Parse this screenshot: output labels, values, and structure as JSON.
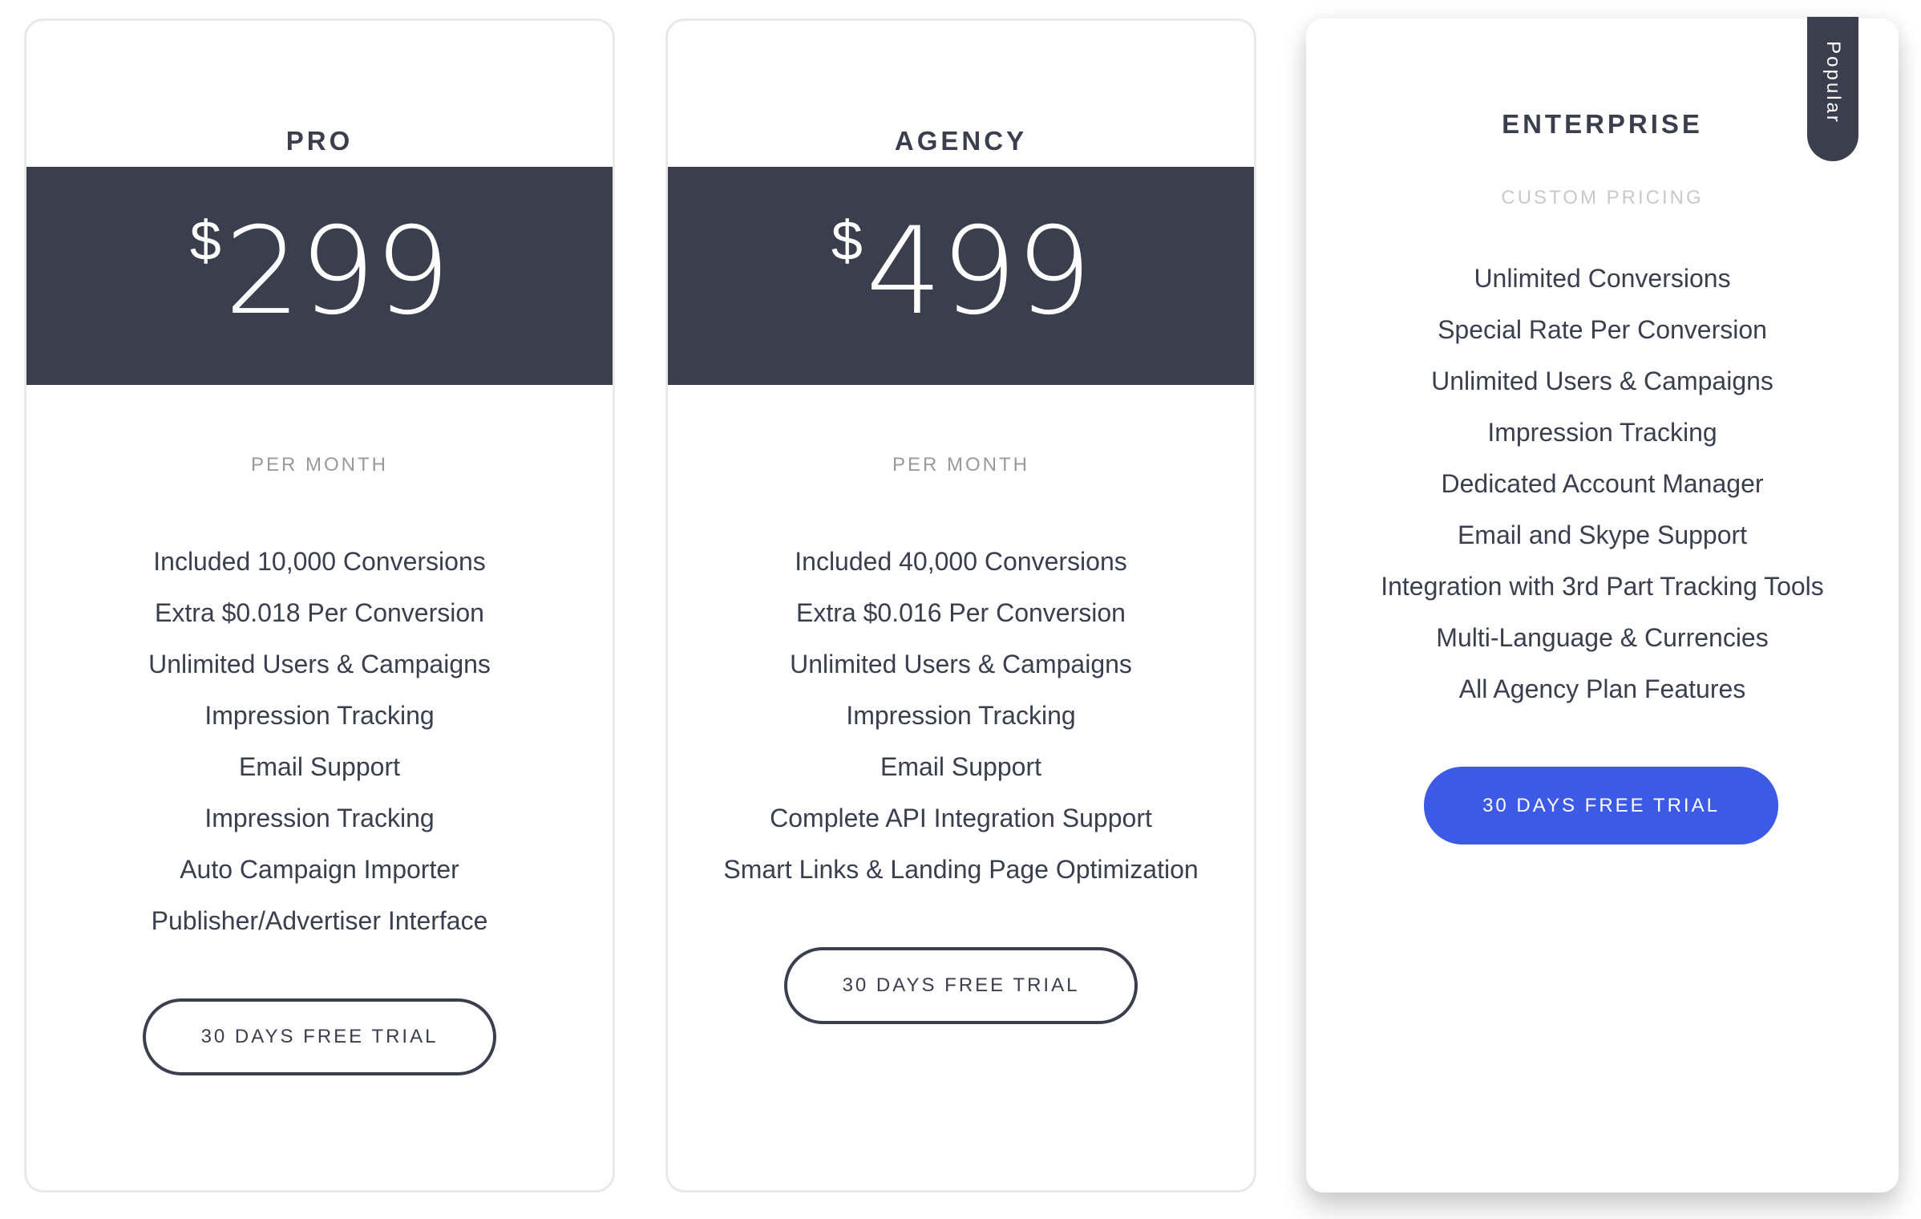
{
  "colors": {
    "dark": "#3b3e4d",
    "accent": "#3d5ae6",
    "muted": "#9a9a9a",
    "faint": "#c9c9c9"
  },
  "plans": [
    {
      "name": "PRO",
      "currency": "$",
      "price": "299",
      "period": "PER MONTH",
      "features": [
        "Included 10,000 Conversions",
        "Extra $0.018 Per Conversion",
        "Unlimited Users & Campaigns",
        "Impression Tracking",
        "Email Support",
        "Impression Tracking",
        "Auto Campaign Importer",
        "Publisher/Advertiser Interface"
      ],
      "cta": "30 DAYS FREE TRIAL"
    },
    {
      "name": "AGENCY",
      "currency": "$",
      "price": "499",
      "period": "PER MONTH",
      "features": [
        "Included 40,000 Conversions",
        "Extra $0.016 Per Conversion",
        "Unlimited Users & Campaigns",
        "Impression Tracking",
        "Email Support",
        "Complete API Integration Support",
        "Smart Links & Landing Page Optimization"
      ],
      "cta": "30 DAYS FREE TRIAL"
    },
    {
      "name": "ENTERPRISE",
      "pricing_note": "CUSTOM PRICING",
      "badge": "Popular",
      "features": [
        "Unlimited Conversions",
        "Special Rate Per Conversion",
        "Unlimited Users & Campaigns",
        "Impression Tracking",
        "Dedicated Account Manager",
        "Email and Skype Support",
        "Integration with 3rd Part Tracking Tools",
        "Multi-Language & Currencies",
        "All Agency Plan Features"
      ],
      "cta": "30 DAYS FREE TRIAL"
    }
  ]
}
